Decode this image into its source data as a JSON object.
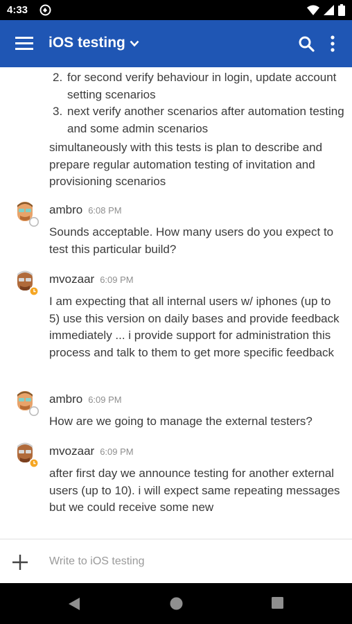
{
  "status_bar": {
    "time": "4:33"
  },
  "app_bar": {
    "title": "iOS testing"
  },
  "channel": {
    "list_items": [
      {
        "number": "2.",
        "text": "for second verify behaviour in login, update account setting scenarios"
      },
      {
        "number": "3.",
        "text": "next verify another scenarios after automation testing and some admin scenarios"
      }
    ],
    "continuation_text": "simultaneously with this tests is plan to describe and prepare regular automation testing of invitation and provisioning scenarios"
  },
  "posts": [
    {
      "username": "ambro",
      "time": "6:08 PM",
      "message": "Sounds acceptable. How many users do you expect to test this particular build?",
      "status": "offline"
    },
    {
      "username": "mvozaar",
      "time": "6:09 PM",
      "message": "I am expecting that all internal users w/ iphones (up to 5) use this version on daily bases and provide feedback immediately ... i provide support for administration this process and talk to them to get more specific feedback",
      "status": "away"
    },
    {
      "username": "ambro",
      "time": "6:09 PM",
      "message": "How are we going to manage the external testers?",
      "status": "offline"
    },
    {
      "username": "mvozaar",
      "time": "6:09 PM",
      "message": "after first day we announce testing for another external users (up to 10). i will expect same repeating messages but we could receive some new",
      "status": "away"
    }
  ],
  "input": {
    "placeholder": "Write to iOS testing"
  },
  "colors": {
    "app_bar": "#1f56b4",
    "away_status": "#f5a623",
    "offline_status": "#ffffff"
  },
  "icons": {
    "menu": "hamburger-menu-icon",
    "title_dropdown": "chevron-down-icon",
    "search": "search-icon",
    "more": "more-vertical-icon",
    "attach": "plus-icon",
    "back": "nav-back-icon",
    "home": "nav-home-icon",
    "recents": "nav-recents-icon"
  }
}
